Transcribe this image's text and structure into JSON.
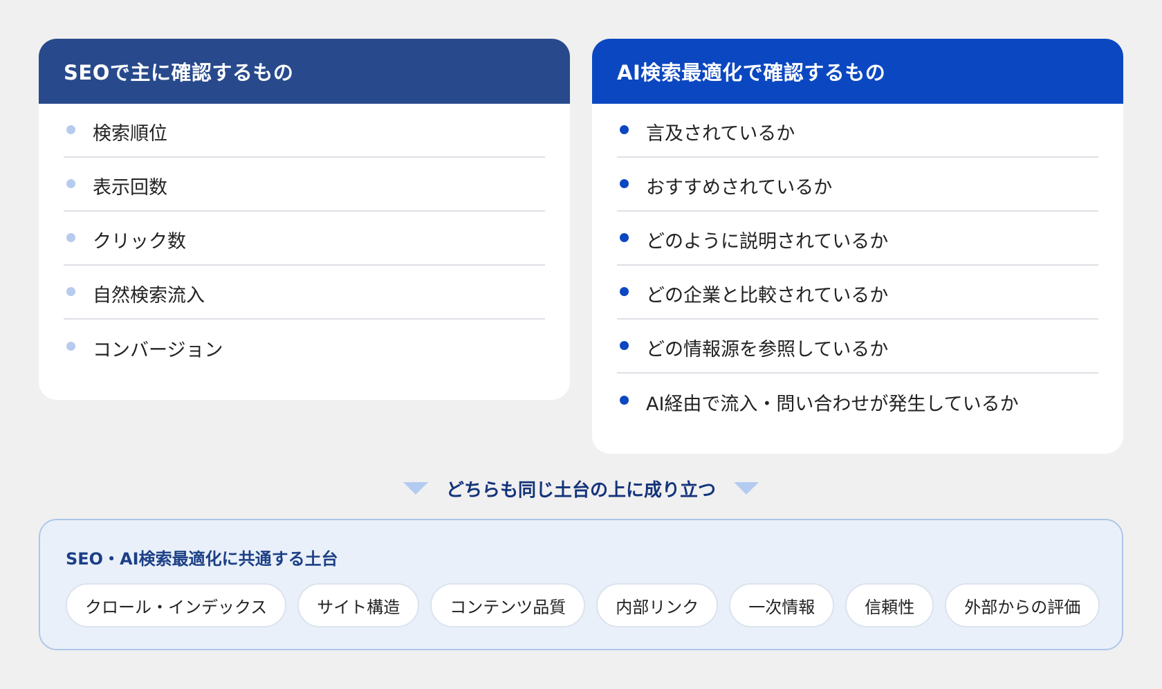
{
  "seo_card": {
    "title": "SEOで主に確認するもの",
    "items": [
      "検索順位",
      "表示回数",
      "クリック数",
      "自然検索流入",
      "コンバージョン"
    ]
  },
  "ai_card": {
    "title": "AI検索最適化で確認するもの",
    "items": [
      "言及されているか",
      "おすすめされているか",
      "どのように説明されているか",
      "どの企業と比較されているか",
      "どの情報源を参照しているか",
      "AI経由で流入・問い合わせが発生しているか"
    ]
  },
  "connector": {
    "text": "どちらも同じ土台の上に成り立つ"
  },
  "foundation": {
    "title": "SEO・AI検索最適化に共通する土台",
    "pills": [
      "クロール・インデックス",
      "サイト構造",
      "コンテンツ品質",
      "内部リンク",
      "一次情報",
      "信頼性",
      "外部からの評価"
    ]
  },
  "colors": {
    "seo_header": "#284a8c",
    "ai_header": "#0b47c1",
    "seo_bullet": "#b6cbee",
    "ai_bullet": "#0b47c1",
    "connector_text": "#14337a",
    "foundation_bg": "#e9f0f9",
    "foundation_border": "#aec7ea",
    "page_bg": "#f0f0f0"
  }
}
